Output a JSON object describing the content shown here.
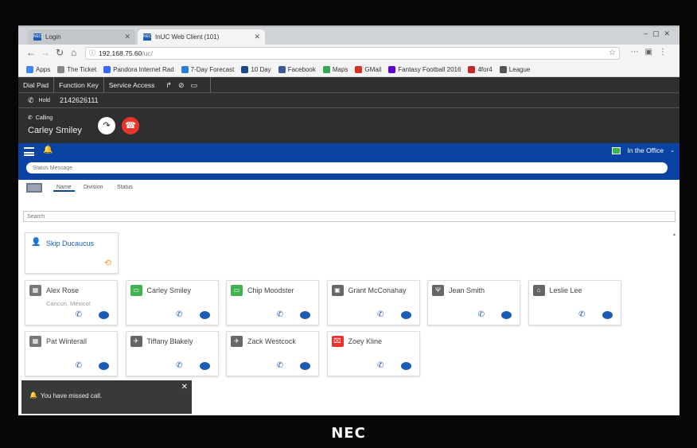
{
  "browser": {
    "tabs": [
      {
        "label": "Login",
        "active": false
      },
      {
        "label": "InUC Web Client (101)",
        "active": true
      }
    ],
    "address": {
      "host": "192.168.75.60",
      "path": "/uc/"
    },
    "bookmarks": [
      {
        "label": "Apps",
        "color": "#4285f4"
      },
      {
        "label": "The Ticket",
        "color": "#888888"
      },
      {
        "label": "Pandora Internet Rad",
        "color": "#3668ff"
      },
      {
        "label": "7-Day Forecast",
        "color": "#2a7fd4"
      },
      {
        "label": "10 Day",
        "color": "#1a4a8a"
      },
      {
        "label": "Facebook",
        "color": "#3b5998"
      },
      {
        "label": "Maps",
        "color": "#34a853"
      },
      {
        "label": "GMail",
        "color": "#d93025"
      },
      {
        "label": "Fantasy Football 2016",
        "color": "#5f01d1"
      },
      {
        "label": "4for4",
        "color": "#c62828"
      },
      {
        "label": "League",
        "color": "#555555"
      }
    ]
  },
  "app": {
    "menu": [
      "Dial Pad",
      "Function Key",
      "Service Access"
    ],
    "hold": {
      "label": "Hold",
      "number": "2142626111"
    },
    "call": {
      "state": "Calling",
      "name": "Carley Smiley"
    },
    "presence": {
      "label": "In the Office",
      "color": "#3fb34f"
    },
    "status_placeholder": "Status Message",
    "filter_tabs": [
      "Name",
      "Division",
      "Status"
    ],
    "search_placeholder": "Search",
    "self_card": {
      "name": "Skip Ducaucus"
    },
    "contacts": [
      {
        "name": "Alex Rose",
        "location": "Cancun, Mexico!",
        "status_icon": "calendar-icon",
        "color": "#777777"
      },
      {
        "name": "Carley Smiley",
        "location": "",
        "status_icon": "monitor-icon",
        "color": "#3fb34f"
      },
      {
        "name": "Chip Moodster",
        "location": "",
        "status_icon": "monitor-icon",
        "color": "#3fb34f"
      },
      {
        "name": "Grant McConahay",
        "location": "",
        "status_icon": "presentation-icon",
        "color": "#666666"
      },
      {
        "name": "Jean Smith",
        "location": "",
        "status_icon": "dining-icon",
        "color": "#666666"
      },
      {
        "name": "Leslie Lee",
        "location": "",
        "status_icon": "home-icon",
        "color": "#666666"
      },
      {
        "name": "Pat Winterall",
        "location": "",
        "status_icon": "calendar-icon",
        "color": "#777777"
      },
      {
        "name": "Tiffany Blakely",
        "location": "",
        "status_icon": "airplane-icon",
        "color": "#666666"
      },
      {
        "name": "Zack Westcock",
        "location": "",
        "status_icon": "airplane-icon",
        "color": "#666666"
      },
      {
        "name": "Zoey Kline",
        "location": "",
        "status_icon": "gift-icon",
        "color": "#e8342a"
      }
    ],
    "toast": {
      "message": "You have missed call."
    }
  },
  "monitor_brand": "NEC"
}
